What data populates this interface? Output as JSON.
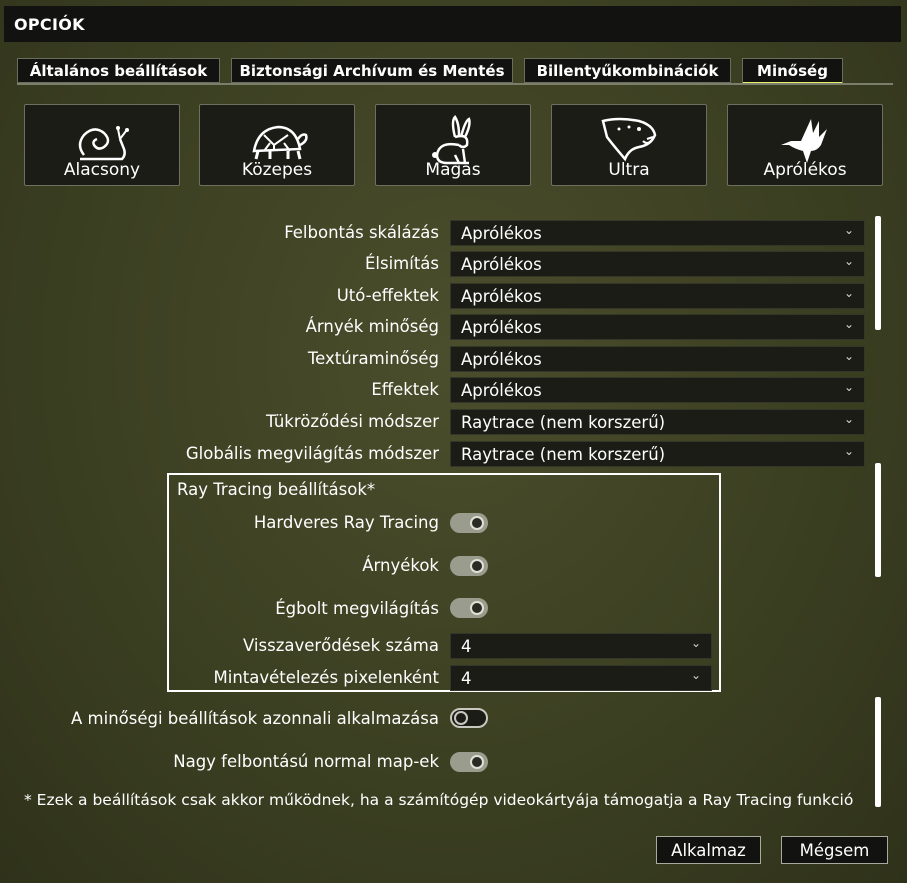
{
  "window": {
    "title": "OPCIÓK"
  },
  "tabs": [
    {
      "label": "Általános beállítások",
      "active": false
    },
    {
      "label": "Biztonsági Archívum és Mentés",
      "active": false
    },
    {
      "label": "Billentyűkombinációk",
      "active": false
    },
    {
      "label": "Minőség",
      "active": true
    }
  ],
  "presets": [
    {
      "label": "Alacsony",
      "icon": "snail-icon"
    },
    {
      "label": "Közepes",
      "icon": "turtle-icon"
    },
    {
      "label": "Magas",
      "icon": "rabbit-icon"
    },
    {
      "label": "Ultra",
      "icon": "cheetah-icon"
    },
    {
      "label": "Aprólékos",
      "icon": "hummingbird-icon"
    }
  ],
  "settings": [
    {
      "label": "Felbontás skálázás",
      "value": "Aprólékos"
    },
    {
      "label": "Élsimítás",
      "value": "Aprólékos"
    },
    {
      "label": "Utó-effektek",
      "value": "Aprólékos"
    },
    {
      "label": "Árnyék minőség",
      "value": "Aprólékos"
    },
    {
      "label": "Textúraminőség",
      "value": "Aprólékos"
    },
    {
      "label": "Effektek",
      "value": "Aprólékos"
    },
    {
      "label": "Tükröződési módszer",
      "value": "Raytrace (nem korszerű)"
    },
    {
      "label": "Globális megvilágítás módszer",
      "value": "Raytrace (nem korszerű)"
    }
  ],
  "raytracing": {
    "title": "Ray Tracing beállítások*",
    "toggles": [
      {
        "label": "Hardveres Ray Tracing",
        "on": true
      },
      {
        "label": "Árnyékok",
        "on": true
      },
      {
        "label": "Égbolt megvilágítás",
        "on": true
      }
    ],
    "selects": [
      {
        "label": "Visszaverődések száma",
        "value": "4"
      },
      {
        "label": "Mintavételezés pixelenként",
        "value": "4"
      }
    ]
  },
  "extra_toggles": [
    {
      "label": "A minőségi beállítások azonnali alkalmazása",
      "on": false
    },
    {
      "label": "Nagy felbontású normal map-ek",
      "on": true
    }
  ],
  "footnote": "* Ezek a beállítások csak akkor működnek, ha a számítógép videokártyája támogatja a Ray Tracing funkció",
  "buttons": {
    "apply": "Alkalmaz",
    "cancel": "Mégsem"
  },
  "colors": {
    "tab_active_underline": "#e8f06a",
    "background": "#3c4022",
    "panel": "#1b1c15"
  }
}
